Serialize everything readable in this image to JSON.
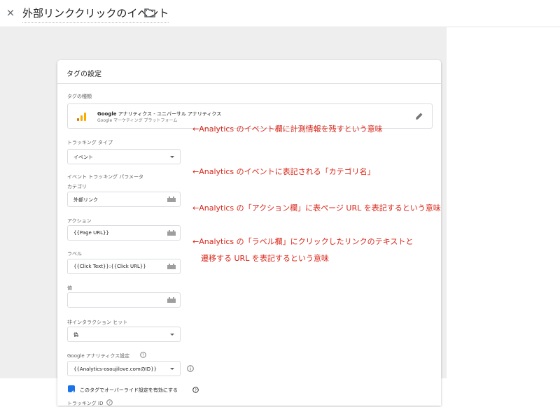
{
  "header": {
    "close_icon": "×",
    "title": "外部リンククリックのイベント"
  },
  "card": {
    "title": "タグの設定",
    "tag_type_label": "タグの種類",
    "tag_type_name_bold": "Google",
    "tag_type_name_rest": " アナリティクス - ユニバーサル アナリティクス",
    "tag_type_sub": "Google マーケティング プラットフォーム",
    "tracking_type_label": "トラッキング タイプ",
    "tracking_type_value": "イベント",
    "event_params_label": "イベント トラッキング パラメータ",
    "category_label": "カテゴリ",
    "category_value": "外部リンク",
    "action_label": "アクション",
    "action_value": "{{Page URL}}",
    "label_label": "ラベル",
    "label_value": "{{Click Text}}:{{Click URL}}",
    "value_label": "値",
    "value_value": "",
    "noninteraction_label": "非インタラクション ヒット",
    "noninteraction_value": "偽",
    "ga_settings_label": "Google アナリティクス設定",
    "ga_settings_value": "{{Analytics-osoujilove.comのID}}",
    "override_checkbox_label": "このタグでオーバーライド設定を有効にする",
    "tracking_id_label": "トラッキング ID"
  },
  "annotations": {
    "tracking_type": "←Analytics のイベント欄に計測情報を残すという意味",
    "category": "←Analytics のイベントに表記される「カテゴリ名」",
    "action": "←Analytics の「アクション欄」に表ページ URL を表記するという意味",
    "label_line1": "←Analytics の「ラベル欄」にクリックしたリンクのテキストと",
    "label_line2": "遷移する URL を表記するという意味"
  },
  "colors": {
    "annotation": "#d9271a",
    "checkbox": "#1a73e8",
    "ga_orange": "#f9ab00",
    "ga_dark_orange": "#e37400"
  }
}
